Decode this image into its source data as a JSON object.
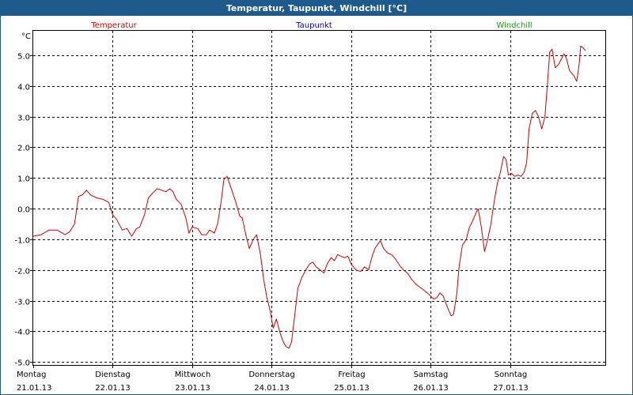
{
  "window": {
    "title": "Temperatur, Taupunkt, Windchill [°C]"
  },
  "chart_data": {
    "type": "line",
    "title": "Temperatur, Taupunkt, Windchill [°C]",
    "ylabel": "°C",
    "ylim": [
      -5.1,
      5.8
    ],
    "yticks": [
      -5.0,
      -4.0,
      -3.0,
      -2.0,
      -1.0,
      0.0,
      1.0,
      2.0,
      3.0,
      4.0,
      5.0
    ],
    "ytick_labels": [
      "-5.0",
      "-4.0",
      "-3.0",
      "-2.0",
      "-1.0",
      "0.0",
      "1.0",
      "2.0",
      "3.0",
      "4.0",
      "5.0"
    ],
    "xlim": [
      0,
      7.2
    ],
    "x_unit": "days from Montag 21.01.13 00:00",
    "xticks": [
      {
        "day": "Montag",
        "date": "21.01.13"
      },
      {
        "day": "Dienstag",
        "date": "22.01.13"
      },
      {
        "day": "Mittwoch",
        "date": "23.01.13"
      },
      {
        "day": "Donnerstag",
        "date": "24.01.13"
      },
      {
        "day": "Freitag",
        "date": "25.01.13"
      },
      {
        "day": "Samstag",
        "date": "26.01.13"
      },
      {
        "day": "Sonntag",
        "date": "27.01.13"
      }
    ],
    "grid": true,
    "legend_position": "top",
    "series": [
      {
        "name": "Temperatur",
        "color": "#cc0000",
        "points": [
          [
            0.0,
            -0.9
          ],
          [
            0.1,
            -0.85
          ],
          [
            0.2,
            -0.7
          ],
          [
            0.3,
            -0.7
          ],
          [
            0.4,
            -0.85
          ],
          [
            0.46,
            -0.75
          ],
          [
            0.52,
            -0.5
          ],
          [
            0.57,
            0.4
          ],
          [
            0.62,
            0.45
          ],
          [
            0.67,
            0.6
          ],
          [
            0.72,
            0.45
          ],
          [
            0.8,
            0.35
          ],
          [
            0.88,
            0.3
          ],
          [
            0.95,
            0.2
          ],
          [
            1.0,
            -0.2
          ],
          [
            1.05,
            -0.35
          ],
          [
            1.12,
            -0.7
          ],
          [
            1.18,
            -0.65
          ],
          [
            1.24,
            -0.9
          ],
          [
            1.3,
            -0.65
          ],
          [
            1.34,
            -0.6
          ],
          [
            1.4,
            -0.2
          ],
          [
            1.45,
            0.35
          ],
          [
            1.5,
            0.5
          ],
          [
            1.56,
            0.65
          ],
          [
            1.62,
            0.6
          ],
          [
            1.67,
            0.55
          ],
          [
            1.72,
            0.65
          ],
          [
            1.76,
            0.55
          ],
          [
            1.8,
            0.3
          ],
          [
            1.86,
            0.15
          ],
          [
            1.92,
            -0.3
          ],
          [
            1.96,
            -0.8
          ],
          [
            2.0,
            -0.6
          ],
          [
            2.07,
            -0.65
          ],
          [
            2.12,
            -0.85
          ],
          [
            2.18,
            -0.85
          ],
          [
            2.22,
            -0.7
          ],
          [
            2.28,
            -0.8
          ],
          [
            2.32,
            -0.5
          ],
          [
            2.36,
            0.15
          ],
          [
            2.4,
            0.95
          ],
          [
            2.44,
            1.05
          ],
          [
            2.5,
            0.6
          ],
          [
            2.55,
            0.2
          ],
          [
            2.6,
            -0.25
          ],
          [
            2.63,
            -0.3
          ],
          [
            2.68,
            -0.9
          ],
          [
            2.72,
            -1.3
          ],
          [
            2.77,
            -1.0
          ],
          [
            2.81,
            -0.85
          ],
          [
            2.86,
            -1.5
          ],
          [
            2.9,
            -2.3
          ],
          [
            2.94,
            -2.9
          ],
          [
            2.98,
            -3.3
          ],
          [
            3.02,
            -3.9
          ],
          [
            3.06,
            -3.6
          ],
          [
            3.1,
            -4.0
          ],
          [
            3.14,
            -4.3
          ],
          [
            3.18,
            -4.5
          ],
          [
            3.22,
            -4.55
          ],
          [
            3.25,
            -4.35
          ],
          [
            3.29,
            -3.5
          ],
          [
            3.33,
            -2.6
          ],
          [
            3.38,
            -2.25
          ],
          [
            3.43,
            -2.0
          ],
          [
            3.48,
            -1.8
          ],
          [
            3.52,
            -1.75
          ],
          [
            3.56,
            -1.9
          ],
          [
            3.61,
            -2.0
          ],
          [
            3.66,
            -2.1
          ],
          [
            3.7,
            -1.8
          ],
          [
            3.75,
            -1.6
          ],
          [
            3.79,
            -1.7
          ],
          [
            3.83,
            -1.5
          ],
          [
            3.87,
            -1.55
          ],
          [
            3.92,
            -1.6
          ],
          [
            3.96,
            -1.55
          ],
          [
            4.0,
            -1.8
          ],
          [
            4.06,
            -2.0
          ],
          [
            4.12,
            -2.05
          ],
          [
            4.17,
            -1.9
          ],
          [
            4.22,
            -2.0
          ],
          [
            4.26,
            -1.6
          ],
          [
            4.3,
            -1.3
          ],
          [
            4.34,
            -1.15
          ],
          [
            4.37,
            -1.05
          ],
          [
            4.41,
            -1.3
          ],
          [
            4.46,
            -1.45
          ],
          [
            4.51,
            -1.5
          ],
          [
            4.56,
            -1.65
          ],
          [
            4.61,
            -1.85
          ],
          [
            4.66,
            -2.0
          ],
          [
            4.71,
            -2.1
          ],
          [
            4.76,
            -2.3
          ],
          [
            4.81,
            -2.45
          ],
          [
            4.86,
            -2.55
          ],
          [
            4.91,
            -2.65
          ],
          [
            4.96,
            -2.75
          ],
          [
            5.0,
            -2.85
          ],
          [
            5.04,
            -2.95
          ],
          [
            5.08,
            -2.9
          ],
          [
            5.12,
            -2.75
          ],
          [
            5.16,
            -2.85
          ],
          [
            5.21,
            -3.2
          ],
          [
            5.26,
            -3.5
          ],
          [
            5.29,
            -3.45
          ],
          [
            5.33,
            -2.8
          ],
          [
            5.36,
            -1.9
          ],
          [
            5.4,
            -1.2
          ],
          [
            5.45,
            -1.0
          ],
          [
            5.49,
            -0.6
          ],
          [
            5.53,
            -0.4
          ],
          [
            5.57,
            -0.15
          ],
          [
            5.6,
            0.0
          ],
          [
            5.64,
            -0.6
          ],
          [
            5.68,
            -1.4
          ],
          [
            5.72,
            -1.0
          ],
          [
            5.76,
            -0.5
          ],
          [
            5.8,
            0.2
          ],
          [
            5.84,
            0.8
          ],
          [
            5.88,
            1.2
          ],
          [
            5.92,
            1.7
          ],
          [
            5.95,
            1.6
          ],
          [
            5.98,
            1.1
          ],
          [
            6.02,
            1.15
          ],
          [
            6.06,
            1.05
          ],
          [
            6.1,
            1.1
          ],
          [
            6.14,
            1.05
          ],
          [
            6.18,
            1.2
          ],
          [
            6.21,
            1.5
          ],
          [
            6.24,
            2.6
          ],
          [
            6.28,
            3.1
          ],
          [
            6.32,
            3.2
          ],
          [
            6.36,
            3.0
          ],
          [
            6.4,
            2.6
          ],
          [
            6.44,
            3.0
          ],
          [
            6.47,
            4.0
          ],
          [
            6.5,
            5.1
          ],
          [
            6.53,
            5.2
          ],
          [
            6.57,
            4.6
          ],
          [
            6.61,
            4.7
          ],
          [
            6.65,
            4.9
          ],
          [
            6.68,
            5.05
          ],
          [
            6.71,
            4.9
          ],
          [
            6.75,
            4.5
          ],
          [
            6.8,
            4.35
          ],
          [
            6.84,
            4.15
          ],
          [
            6.87,
            4.7
          ],
          [
            6.89,
            5.3
          ],
          [
            6.92,
            5.25
          ],
          [
            6.95,
            5.15
          ]
        ]
      },
      {
        "name": "Taupunkt",
        "color": "#0000cc",
        "points": []
      },
      {
        "name": "Windchill",
        "color": "#00aa00",
        "points": []
      }
    ]
  }
}
